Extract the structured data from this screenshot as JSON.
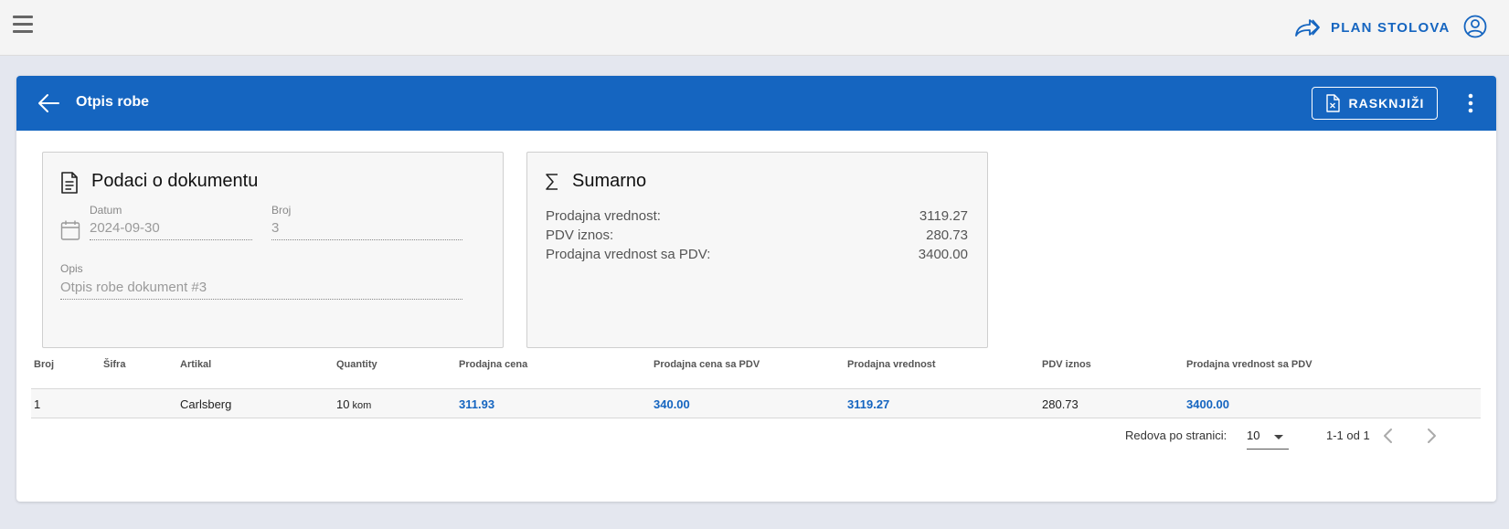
{
  "topbar": {
    "menu_icon": "hamburger-icon",
    "plan_label": "PLAN STOLOVA",
    "plan_icon": "forward-share-icon",
    "user_icon": "account-circle-icon",
    "accent": "#1565c0"
  },
  "header": {
    "title": "Otpis robe",
    "back_icon": "arrow-left-icon",
    "action_label": "RASKNJIŽI",
    "action_icon": "file-cancel-icon",
    "more_icon": "dots-vertical-icon",
    "bg": "#1565c0"
  },
  "document": {
    "title": "Podaci o dokumentu",
    "icon": "document-text-icon",
    "date_label": "Datum",
    "date_value": "2024-09-30",
    "date_icon": "calendar-icon",
    "number_label": "Broj",
    "number_value": "3",
    "desc_label": "Opis",
    "desc_value": "Otpis robe dokument #3"
  },
  "summary": {
    "title": "Sumarno",
    "icon": "sigma-icon",
    "rows": [
      {
        "label": "Prodajna vrednost:",
        "value": "3119.27"
      },
      {
        "label": "PDV iznos:",
        "value": "280.73"
      },
      {
        "label": "Prodajna vrednost sa PDV:",
        "value": "3400.00"
      }
    ]
  },
  "table": {
    "columns": [
      "Broj",
      "Šifra",
      "Artikal",
      "Quantity",
      "Prodajna cena",
      "Prodajna cena sa PDV",
      "Prodajna vrednost",
      "PDV iznos",
      "Prodajna vrednost sa PDV"
    ],
    "rows": [
      {
        "broj": "1",
        "sifra": "",
        "artikal": "Carlsberg",
        "qty": "10",
        "unit": "kom",
        "cena": "311.93",
        "cena_pdv": "340.00",
        "vrednost": "3119.27",
        "pdv": "280.73",
        "vrednost_pdv": "3400.00"
      }
    ]
  },
  "pagination": {
    "rows_label": "Redova po stranici:",
    "rows_value": "10",
    "range": "1-1 od 1",
    "prev_icon": "chevron-left-icon",
    "next_icon": "chevron-right-icon"
  }
}
